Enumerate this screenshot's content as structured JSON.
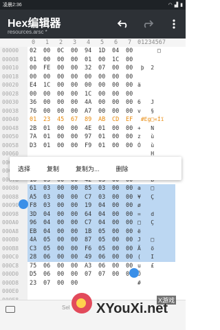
{
  "status": {
    "time": "凌晨2:36"
  },
  "appbar": {
    "title": "Hex编辑器",
    "subtitle": "resources.arsc *"
  },
  "header": {
    "cols": [
      "0",
      "1",
      "2",
      "3",
      "4",
      "5",
      "6",
      "7"
    ],
    "text_header": "01234567"
  },
  "rows": [
    {
      "off": "00000",
      "cells": [
        "02",
        "00",
        "0C",
        "00",
        "94",
        "1D",
        "04",
        "00"
      ],
      "text": "      □"
    },
    {
      "off": "00008",
      "cells": [
        "01",
        "00",
        "00",
        "00",
        "01",
        "00",
        "1C",
        "00"
      ],
      "text": ""
    },
    {
      "off": "00010",
      "cells": [
        "00",
        "FE",
        "00",
        "00",
        "32",
        "07",
        "00",
        "00"
      ],
      "text": " þ  2"
    },
    {
      "off": "00018",
      "cells": [
        "00",
        "00",
        "00",
        "00",
        "00",
        "00",
        "00",
        "00"
      ],
      "text": ""
    },
    {
      "off": "00020",
      "cells": [
        "E4",
        "1C",
        "00",
        "00",
        "00",
        "00",
        "00",
        "00"
      ],
      "text": "ä"
    },
    {
      "off": "00028",
      "cells": [
        "00",
        "00",
        "00",
        "00",
        "1C",
        "00",
        "00",
        "00"
      ],
      "text": ""
    },
    {
      "off": "00030",
      "cells": [
        "36",
        "00",
        "00",
        "00",
        "4A",
        "00",
        "00",
        "00"
      ],
      "text": "6   J"
    },
    {
      "off": "00038",
      "cells": [
        "76",
        "00",
        "00",
        "00",
        "A7",
        "00",
        "00",
        "00"
      ],
      "text": "v   §"
    },
    {
      "off": "00040",
      "cells": [
        "01",
        "23",
        "45",
        "67",
        "89",
        "AB",
        "CD",
        "EF"
      ],
      "text": " #Eg□«Íï"
    },
    {
      "off": "00048",
      "cells": [
        "2B",
        "01",
        "00",
        "00",
        "4E",
        "01",
        "00",
        "00"
      ],
      "text": "+   N"
    },
    {
      "off": "00050",
      "cells": [
        "7A",
        "01",
        "00",
        "00",
        "97",
        "01",
        "00",
        "00"
      ],
      "text": "z   ù"
    },
    {
      "off": "00058",
      "cells": [
        "D3",
        "01",
        "00",
        "00",
        "F9",
        "01",
        "00",
        "00"
      ],
      "text": "Ó   ù"
    },
    {
      "off": "00060",
      "cells": [
        "",
        "",
        "",
        "",
        "",
        "",
        "",
        ""
      ],
      "text": "    H"
    },
    {
      "off": "00068",
      "cells": [
        "",
        "",
        "",
        "",
        "",
        "",
        "",
        ""
      ],
      "text": "    è"
    },
    {
      "off": "00070",
      "cells": [
        "",
        "",
        "",
        "",
        "",
        "",
        "",
        ""
      ],
      "text": "    B"
    },
    {
      "off": "00078",
      "cells": [
        "18",
        "03",
        "00",
        "00",
        "42",
        "03",
        "00",
        "00"
      ],
      "text": "    B"
    },
    {
      "off": "00080",
      "cells": [
        "61",
        "03",
        "00",
        "00",
        "85",
        "03",
        "00",
        "00"
      ],
      "text": "a   □"
    },
    {
      "off": "00088",
      "cells": [
        "A5",
        "03",
        "00",
        "00",
        "C7",
        "03",
        "00",
        "00"
      ],
      "text": "¥   Ç"
    },
    {
      "off": "00090",
      "cells": [
        "F8",
        "03",
        "00",
        "00",
        "19",
        "04",
        "00",
        "00"
      ],
      "text": "ø"
    },
    {
      "off": "00098",
      "cells": [
        "3D",
        "04",
        "00",
        "00",
        "64",
        "04",
        "00",
        "00"
      ],
      "text": "=   d"
    },
    {
      "off": "000A0",
      "cells": [
        "96",
        "04",
        "00",
        "00",
        "C7",
        "04",
        "00",
        "00"
      ],
      "text": "□   Ç"
    },
    {
      "off": "000A8",
      "cells": [
        "EB",
        "04",
        "00",
        "00",
        "1B",
        "05",
        "00",
        "00"
      ],
      "text": "ë"
    },
    {
      "off": "000B0",
      "cells": [
        "4A",
        "05",
        "00",
        "00",
        "87",
        "05",
        "00",
        "00"
      ],
      "text": "J   □"
    },
    {
      "off": "000B8",
      "cells": [
        "C3",
        "05",
        "00",
        "00",
        "F6",
        "05",
        "00",
        "00"
      ],
      "text": "Ã   ö"
    },
    {
      "off": "000C0",
      "cells": [
        "28",
        "06",
        "00",
        "00",
        "49",
        "06",
        "00",
        "00"
      ],
      "text": "(   I"
    },
    {
      "off": "000C8",
      "cells": [
        "75",
        "06",
        "00",
        "00",
        "A3",
        "06",
        "00",
        "00"
      ],
      "text": "u   £"
    },
    {
      "off": "000D0",
      "cells": [
        "D5",
        "06",
        "00",
        "00",
        "07",
        "07",
        "00",
        "00"
      ],
      "text": "Õ"
    },
    {
      "off": "000D8",
      "cells": [
        "23",
        "07",
        "00",
        "00",
        "",
        "",
        "",
        ""
      ],
      "text": "#"
    },
    {
      "off": "000E0",
      "cells": [
        "",
        "",
        "",
        "",
        "",
        "",
        "",
        ""
      ],
      "text": ""
    },
    {
      "off": "000E8",
      "cells": [
        "",
        "",
        "",
        "",
        "",
        "",
        "",
        ""
      ],
      "text": ""
    }
  ],
  "context_menu": {
    "items": [
      "选择",
      "复制",
      "复制为...",
      "删除"
    ]
  },
  "bottom": {
    "text": "Sel"
  },
  "watermark": {
    "url": "XYouXi.net",
    "tag": "X游戏"
  }
}
